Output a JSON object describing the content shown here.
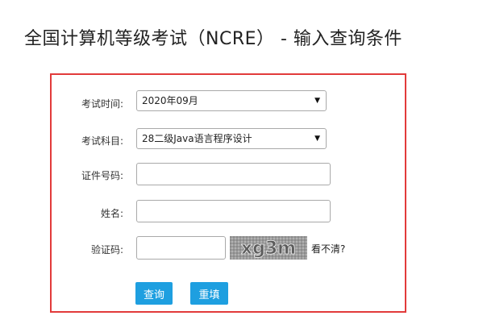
{
  "header": {
    "title": "全国计算机等级考试（NCRE） - 输入查询条件"
  },
  "form": {
    "exam_time": {
      "label": "考试时间:",
      "selected": "2020年09月",
      "icon": "dropdown-arrow-icon"
    },
    "exam_subject": {
      "label": "考试科目:",
      "selected": "28二级Java语言程序设计",
      "icon": "dropdown-arrow-icon"
    },
    "id_number": {
      "label": "证件号码:",
      "value": "",
      "placeholder": ""
    },
    "name": {
      "label": "姓名:",
      "value": "",
      "placeholder": ""
    },
    "captcha": {
      "label": "验证码:",
      "value": "",
      "image_text": "xg3m",
      "refresh_link": "看不清?"
    },
    "buttons": {
      "query": "查询",
      "reset": "重填"
    }
  },
  "colors": {
    "border": "#e23b3b",
    "button": "#1e9fe0"
  }
}
